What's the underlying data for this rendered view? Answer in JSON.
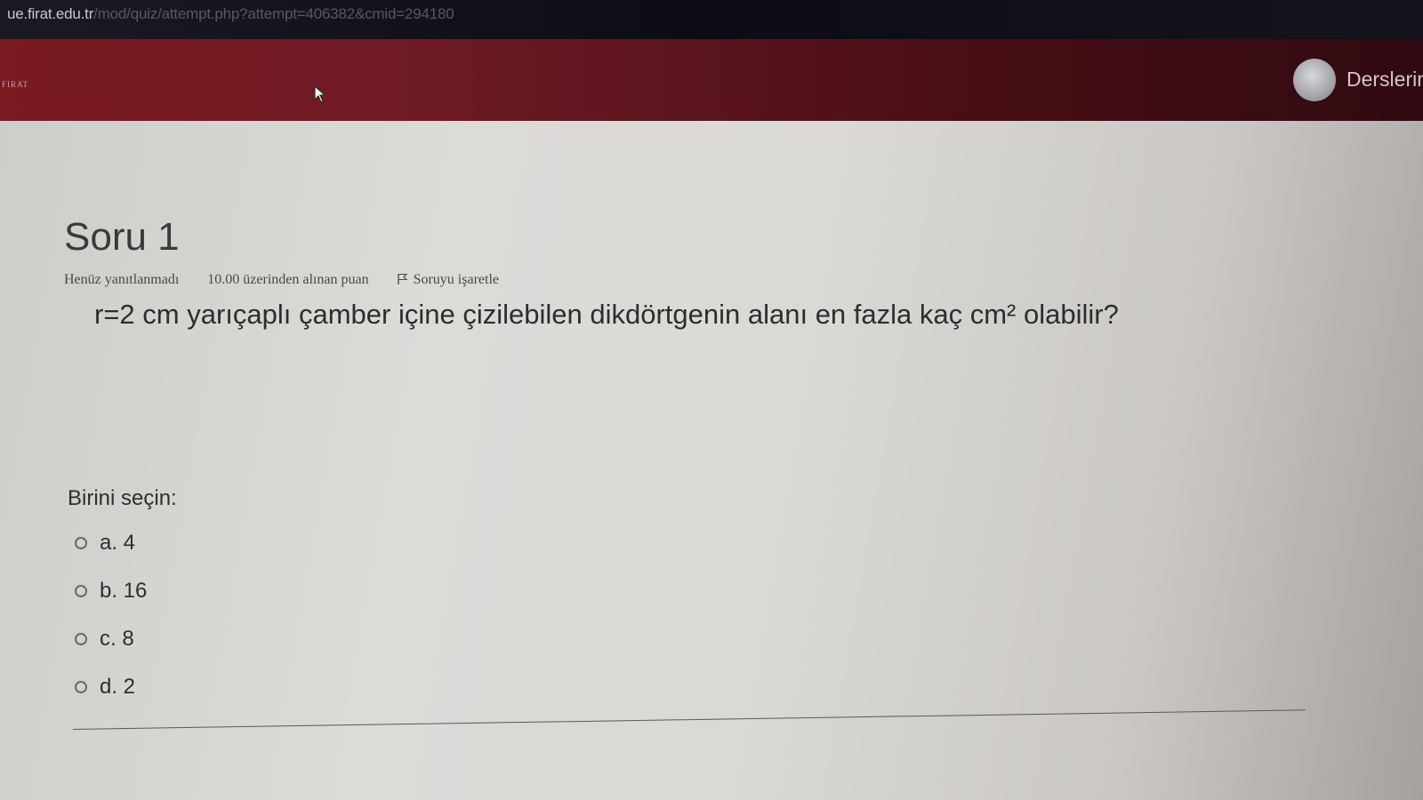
{
  "browser": {
    "url_host": "ue.firat.edu.tr",
    "url_path": "/mod/quiz/attempt.php?attempt=406382&cmid=294180"
  },
  "header": {
    "logo_text": "FIRAT",
    "courses_label": "Derslerim"
  },
  "question": {
    "title": "Soru 1",
    "status": "Henüz yanıtlanmadı",
    "points": "10.00 üzerinden alınan puan",
    "flag_label": "Soruyu işaretle",
    "text": "r=2 cm yarıçaplı çamber içine çizilebilen dikdörtgenin alanı en fazla kaç cm² olabilir?",
    "prompt": "Birini seçin:",
    "options": [
      {
        "label": "a. 4"
      },
      {
        "label": "b. 16"
      },
      {
        "label": "c. 8"
      },
      {
        "label": "d. 2"
      }
    ]
  },
  "icons": {
    "cursor": "mouse-cursor-icon",
    "flag": "flag-icon",
    "avatar": "user-avatar"
  }
}
